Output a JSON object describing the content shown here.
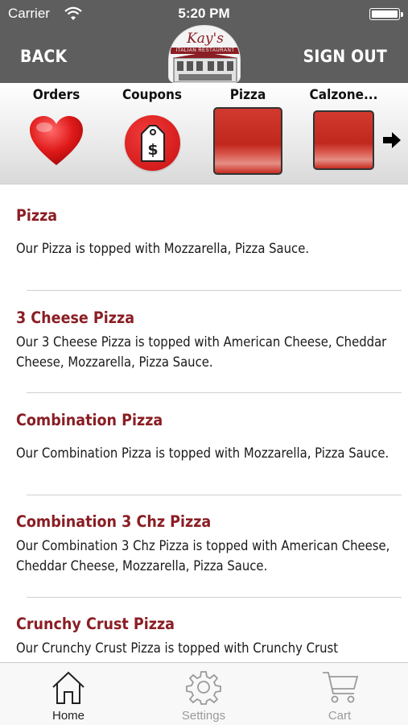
{
  "status_bar": {
    "carrier": "Carrier",
    "time": "5:20 PM"
  },
  "header": {
    "back_label": "BACK",
    "sign_out_label": "SIGN OUT",
    "logo_text": "Kay's",
    "logo_subtext": "ITALIAN RESTAURANT"
  },
  "categories": [
    {
      "label": "Orders",
      "icon": "heart-icon"
    },
    {
      "label": "Coupons",
      "icon": "coupon-tag-icon"
    },
    {
      "label": "Pizza",
      "icon": "pizza-tile",
      "selected": true
    },
    {
      "label": "Calzone...",
      "icon": "calzone-tile"
    }
  ],
  "menu_items": [
    {
      "name": "Pizza",
      "description": "Our Pizza is topped with Mozzarella, Pizza Sauce."
    },
    {
      "name": "3 Cheese Pizza",
      "description": "Our 3 Cheese Pizza is topped with American Cheese, Cheddar Cheese, Mozzarella, Pizza Sauce."
    },
    {
      "name": "Combination Pizza",
      "description": "Our Combination Pizza is topped with Mozzarella, Pizza Sauce."
    },
    {
      "name": "Combination 3 Chz Pizza",
      "description": "Our Combination 3 Chz Pizza is topped with American Cheese, Cheddar Cheese, Mozzarella, Pizza Sauce."
    },
    {
      "name": "Crunchy Crust Pizza",
      "description": "Our Crunchy Crust Pizza is topped with Crunchy Crust"
    }
  ],
  "tabs": [
    {
      "label": "Home",
      "icon": "home-icon",
      "active": true
    },
    {
      "label": "Settings",
      "icon": "gear-icon",
      "active": false
    },
    {
      "label": "Cart",
      "icon": "cart-icon",
      "active": false
    }
  ],
  "colors": {
    "header_bg": "#5e5e5e",
    "item_title": "#8a1e24",
    "accent_red": "#d42a1f"
  }
}
